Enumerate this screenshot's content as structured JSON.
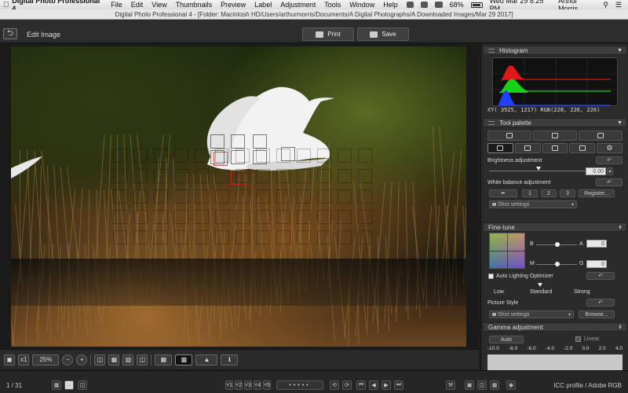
{
  "menubar": {
    "app_name": "Digital Photo Professional 4",
    "items": [
      "File",
      "Edit",
      "View",
      "Thumbnails",
      "Preview",
      "Label",
      "Adjustment",
      "Tools",
      "Window",
      "Help"
    ],
    "battery": "68%",
    "datetime": "Wed Mar 29  8:25 PM",
    "user": "Arthur Morris"
  },
  "window": {
    "title": "Digital Photo Professional 4 - [Folder: Macintosh HD/Users/arthurmorris/Documents/A Digital Photographs/A Downloaded Images/Mar 29 2017]"
  },
  "toolbar": {
    "back_label": "⮌",
    "mode_label": "Edit Image",
    "print_label": "Print",
    "save_label": "Save"
  },
  "viewstrip": {
    "zoom_1x": "x1",
    "zoom_level": "25%",
    "zoom_out": "−",
    "zoom_in": "+"
  },
  "statusbar": {
    "page_counter": "1 / 31",
    "icc_profile": "ICC profile / Adobe RGB",
    "rating_labels": [
      "˅1",
      "˅2",
      "˅3",
      "˅4",
      "˅5"
    ]
  },
  "panel": {
    "histogram": {
      "title": "Histogram",
      "readout": "XY(  3525,   1217) RGB(228, 226, 226)",
      "colors": {
        "red": "#e01818",
        "green": "#18d018",
        "blue": "#2040ff"
      }
    },
    "tool_palette": {
      "title": "Tool palette",
      "brightness_label": "Brightness adjustment",
      "brightness_value": "0.00",
      "brightness_level": 0.5,
      "wb_label": "White balance adjustment",
      "wb_presets": [
        "1",
        "2",
        "3"
      ],
      "register_label": "Register...",
      "wb_select": "Shot settings"
    },
    "fine_tune": {
      "title": "Fine-tune",
      "b_label": "B",
      "a_label": "A",
      "m_label": "M",
      "g_label": "G",
      "a_value": "0",
      "g_value": "0",
      "alo_label": "Auto Lighting Optimizer",
      "alo_levels": [
        "Low",
        "Standard",
        "Strong"
      ],
      "picture_style_label": "Picture Style",
      "picture_style_select": "Shot settings",
      "browse_label": "Browse..."
    },
    "gamma": {
      "title": "Gamma adjustment",
      "auto_label": "Auto",
      "linear_label": "Linear",
      "scale": [
        "-10.0",
        "-8.0",
        "-6.0",
        "-4.0",
        "-2.0",
        "0.0",
        "2.0",
        "4.0"
      ]
    }
  }
}
